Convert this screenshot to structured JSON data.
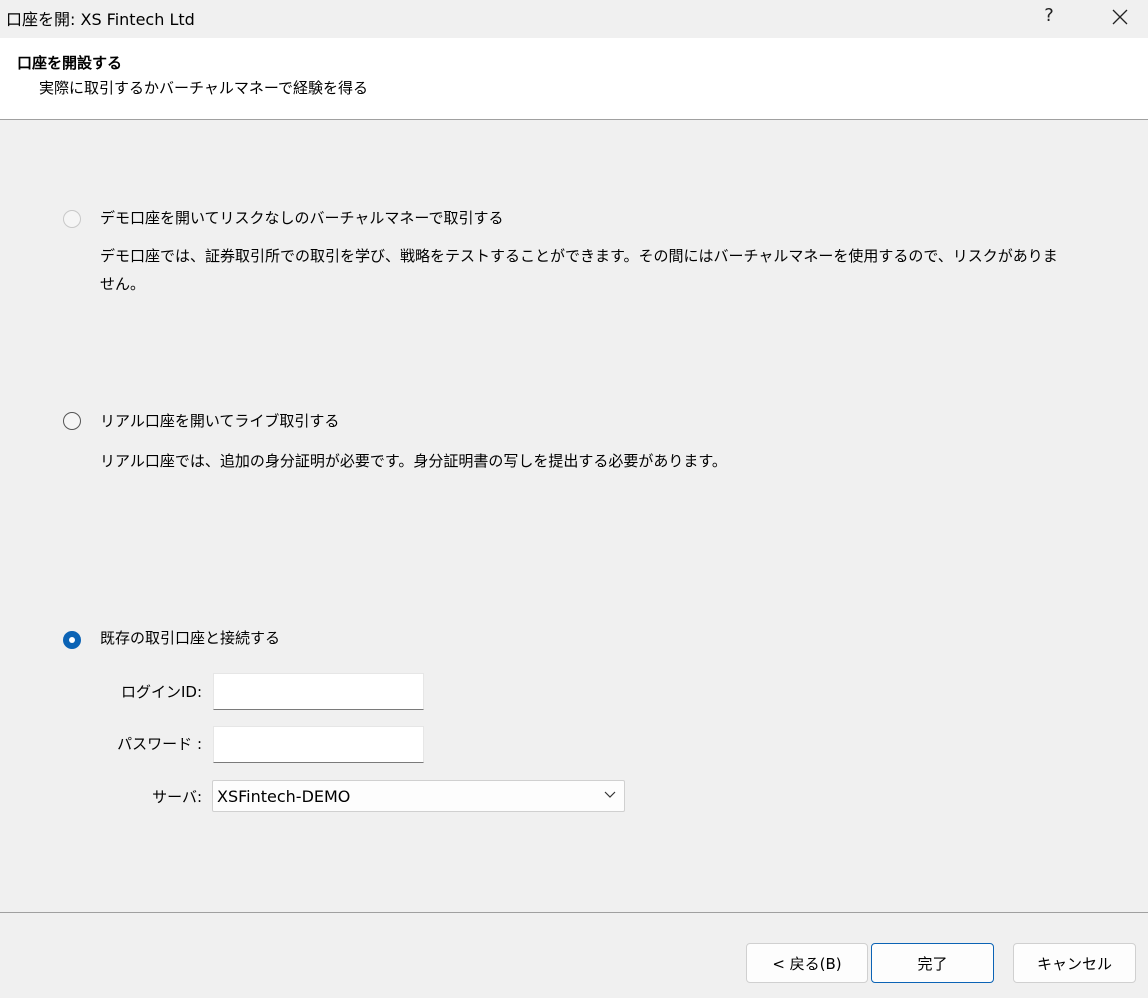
{
  "window": {
    "title": "口座を開: XS Fintech Ltd",
    "help": "?"
  },
  "header": {
    "title": "口座を開設する",
    "subtitle": "実際に取引するかバーチャルマネーで経験を得る"
  },
  "options": [
    {
      "label": "デモ口座を開いてリスクなしのバーチャルマネーで取引する",
      "description": "デモ口座では、証券取引所での取引を学び、戦略をテストすることができます。その間にはバーチャルマネーを使用するので、リスクがありません。",
      "state": "disabled"
    },
    {
      "label": "リアル口座を開いてライブ取引する",
      "description": "リアル口座では、追加の身分証明が必要です。身分証明書の写しを提出する必要があります。",
      "state": "unchecked"
    },
    {
      "label": "既存の取引口座と接続する",
      "state": "checked"
    }
  ],
  "form": {
    "login_label": "ログインID:",
    "login_value": "",
    "password_label": "パスワード :",
    "password_value": "",
    "server_label": "サーバ:",
    "server_value": "XSFintech-DEMO"
  },
  "buttons": {
    "back": "< 戻る(B)",
    "finish": "完了",
    "cancel": "キャンセル"
  },
  "colors": {
    "accent": "#0b63b5",
    "background": "#f0f0f0",
    "header_background": "#ffffff"
  }
}
